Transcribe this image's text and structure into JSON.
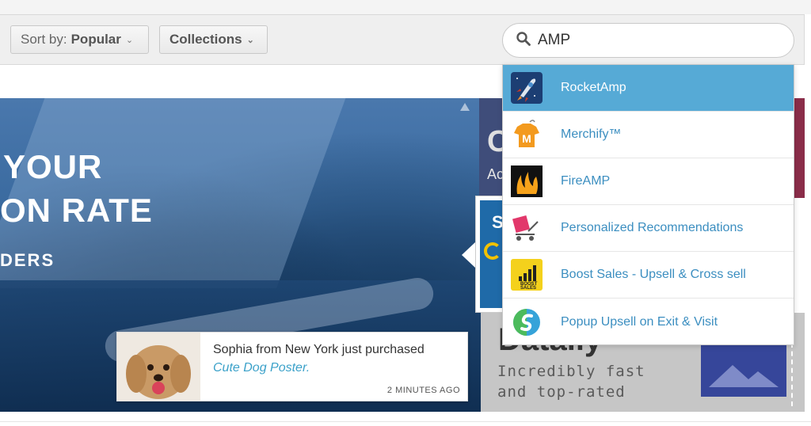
{
  "toolbar": {
    "sort_prefix": "Sort by:",
    "sort_value": "Popular",
    "collections_label": "Collections"
  },
  "search": {
    "value": "AMP",
    "placeholder": ""
  },
  "hero": {
    "line1": "YOUR",
    "line2": "ON RATE",
    "line3": "DERS"
  },
  "notification": {
    "text": "Sophia from New York just purchased",
    "product": "Cute Dog Poster.",
    "time": "2 MINUTES AGO"
  },
  "background_tiles": {
    "top_letter": "C",
    "top_text": "Ac",
    "mid_letter": "S",
    "bottom_title": "Datally",
    "bottom_line1": "Incredibly fast",
    "bottom_line2": "and top-rated"
  },
  "dropdown": {
    "items": [
      {
        "label": "RocketAmp",
        "icon": "rocket-icon",
        "active": true
      },
      {
        "label": "Merchify™",
        "icon": "merchify-shirt-icon",
        "active": false
      },
      {
        "label": "FireAMP",
        "icon": "fire-icon",
        "active": false
      },
      {
        "label": "Personalized Recommendations",
        "icon": "gift-cart-icon",
        "active": false
      },
      {
        "label": "Boost Sales - Upsell & Cross sell",
        "icon": "boost-sales-icon",
        "active": false
      },
      {
        "label": "Popup Upsell on Exit & Visit",
        "icon": "popup-upsell-icon",
        "active": false
      }
    ],
    "active_color": "#56aad6",
    "link_color": "#3b8ec0"
  }
}
